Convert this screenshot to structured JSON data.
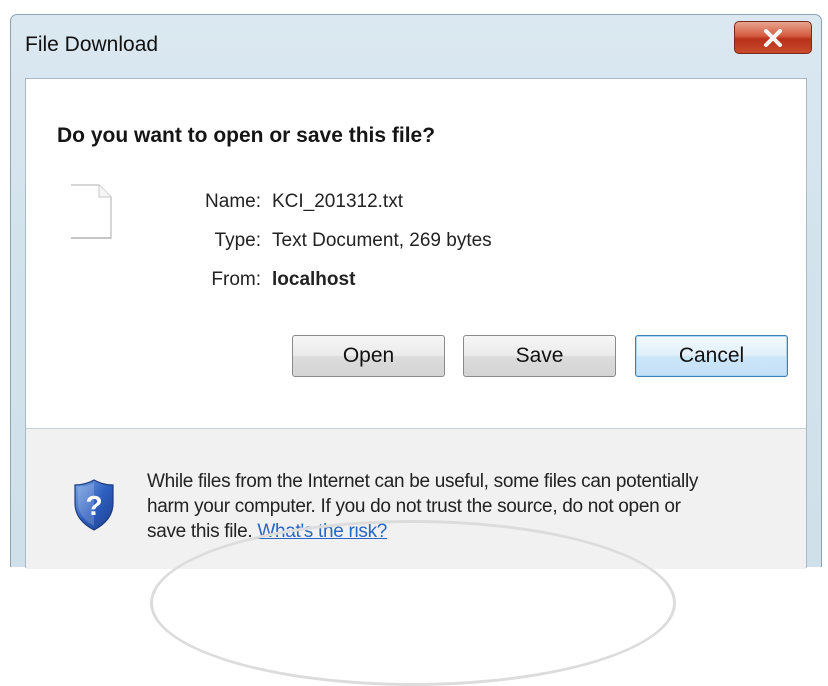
{
  "window": {
    "title": "File Download",
    "close_icon": "close-x-icon"
  },
  "prompt": {
    "question": "Do you want to open or save this file?"
  },
  "file": {
    "icon": "text-file-icon",
    "name_label": "Name:",
    "name_value": "KCI_201312.txt",
    "type_label": "Type:",
    "type_value": "Text Document, 269 bytes",
    "from_label": "From:",
    "from_value": "localhost"
  },
  "buttons": {
    "open": "Open",
    "save": "Save",
    "cancel": "Cancel"
  },
  "footer": {
    "shield_icon": "security-shield-icon",
    "warning_line1": "While files from the Internet can be useful, some files can potentially",
    "warning_line2": "harm your computer. If you do not trust the source, do not open or",
    "warning_line3": "save this file.",
    "risk_link": "What's the risk?"
  },
  "colors": {
    "link": "#2867c5",
    "close_button": "#c9452a",
    "default_button_border": "#3c7fb1"
  }
}
